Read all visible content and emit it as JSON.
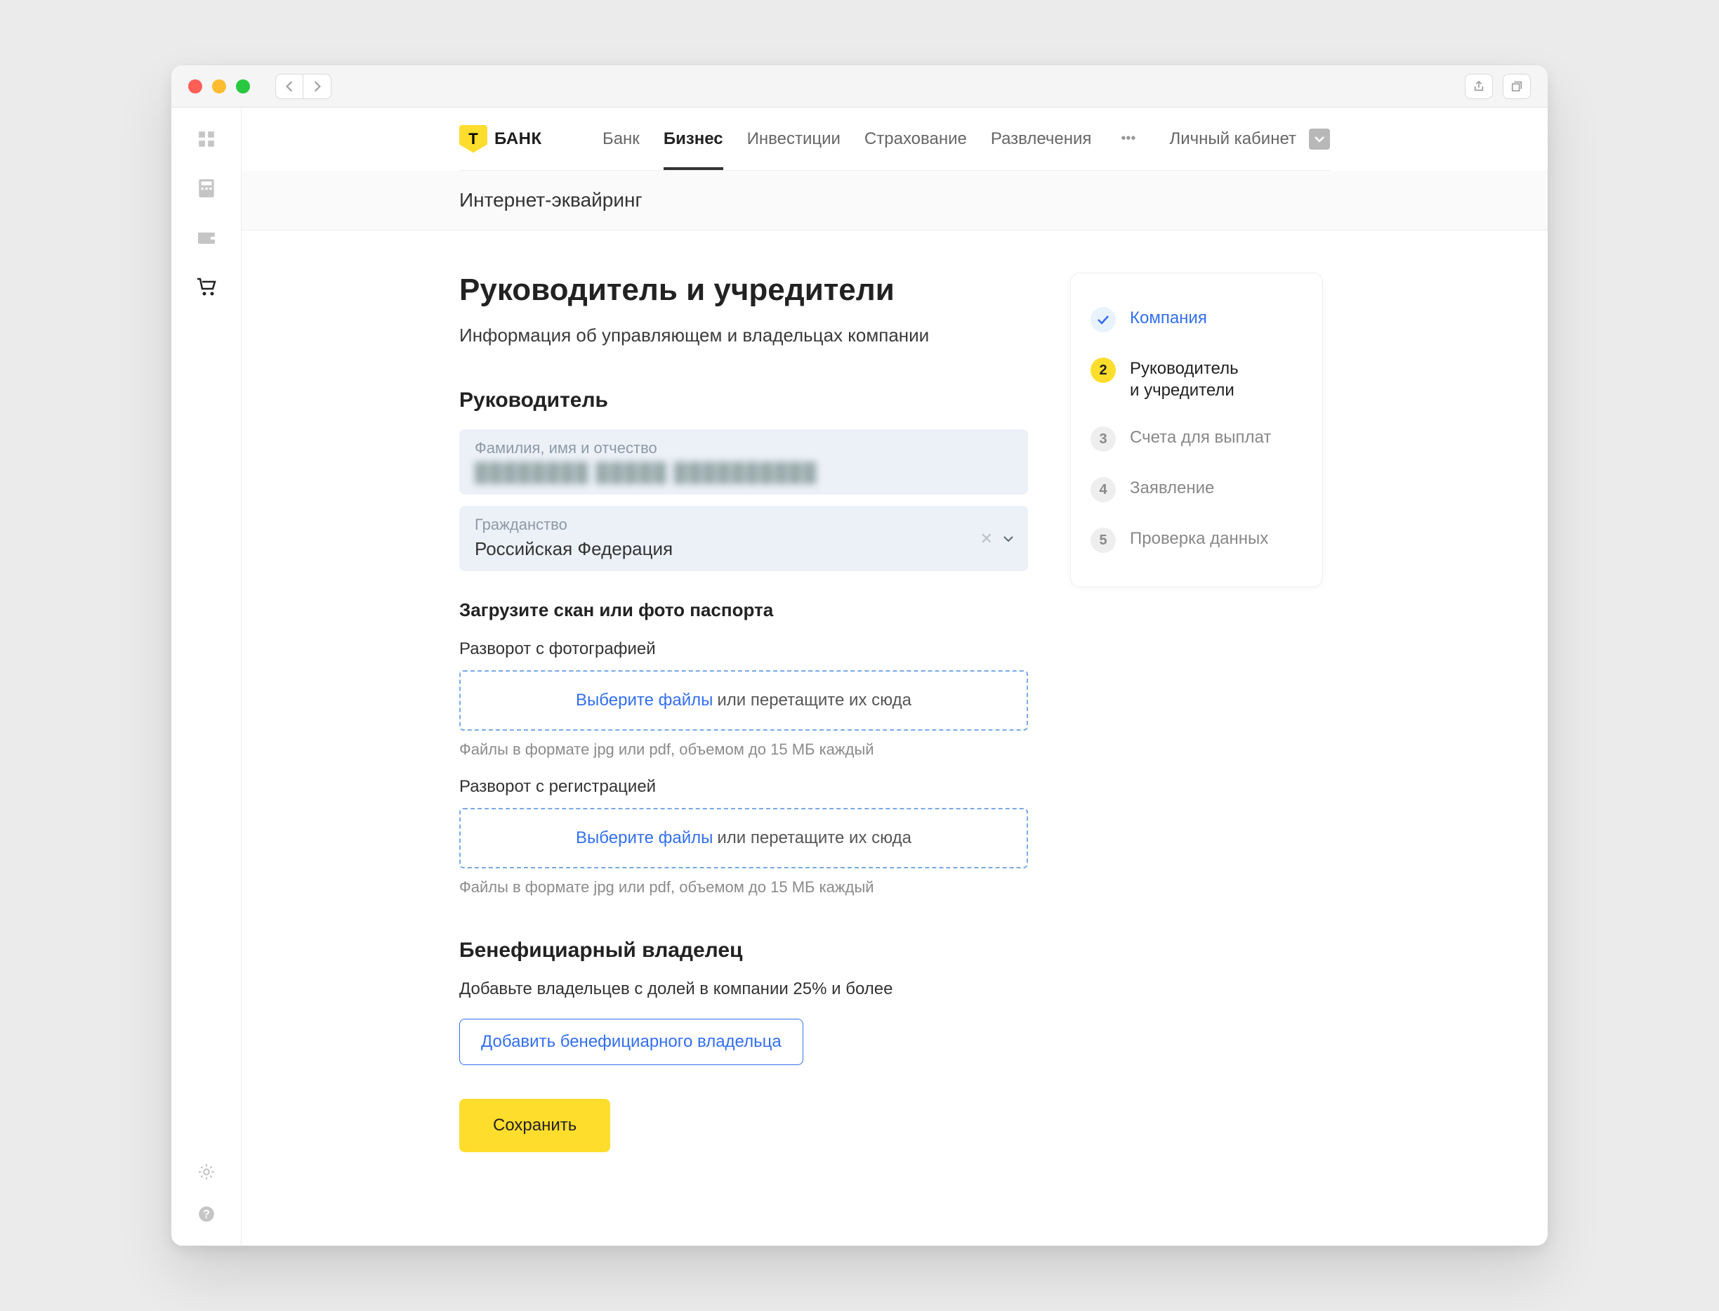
{
  "logo_text": "БАНК",
  "logo_letter": "Т",
  "topnav": {
    "tabs": [
      "Банк",
      "Бизнес",
      "Инвестиции",
      "Страхование",
      "Развлечения"
    ],
    "active_index": 1,
    "account_label": "Личный кабинет"
  },
  "subhead": "Интернет-эквайринг",
  "page_title": "Руководитель и учредители",
  "page_subtitle": "Информация об управляющем и владельцах компании",
  "section_manager": "Руководитель",
  "fields": {
    "fio_label": "Фамилия, имя и отчество",
    "fio_value": "████████  █████  ██████████",
    "citizenship_label": "Гражданство",
    "citizenship_value": "Российская Федерация"
  },
  "passport_heading": "Загрузите скан или фото паспорта",
  "upload_photo_label": "Разворот с фотографией",
  "upload_reg_label": "Разворот с регистрацией",
  "dropzone_link": "Выберите файлы",
  "dropzone_hint": " или перетащите их сюда",
  "file_hint": "Файлы в формате jpg или pdf, объемом до 15 МБ каждый",
  "ben_heading": "Бенефициарный владелец",
  "ben_desc": "Добавьте владельцев с долей в компании 25% и более",
  "ben_add_btn": "Добавить бенефициарного владельца",
  "save_btn": "Сохранить",
  "steps": [
    {
      "label": "Компания",
      "state": "done",
      "badge": "✓"
    },
    {
      "label": "Руководитель\nи учредители",
      "state": "current",
      "badge": "2"
    },
    {
      "label": "Счета для выплат",
      "state": "pending",
      "badge": "3"
    },
    {
      "label": "Заявление",
      "state": "pending",
      "badge": "4"
    },
    {
      "label": "Проверка данных",
      "state": "pending",
      "badge": "5"
    }
  ]
}
